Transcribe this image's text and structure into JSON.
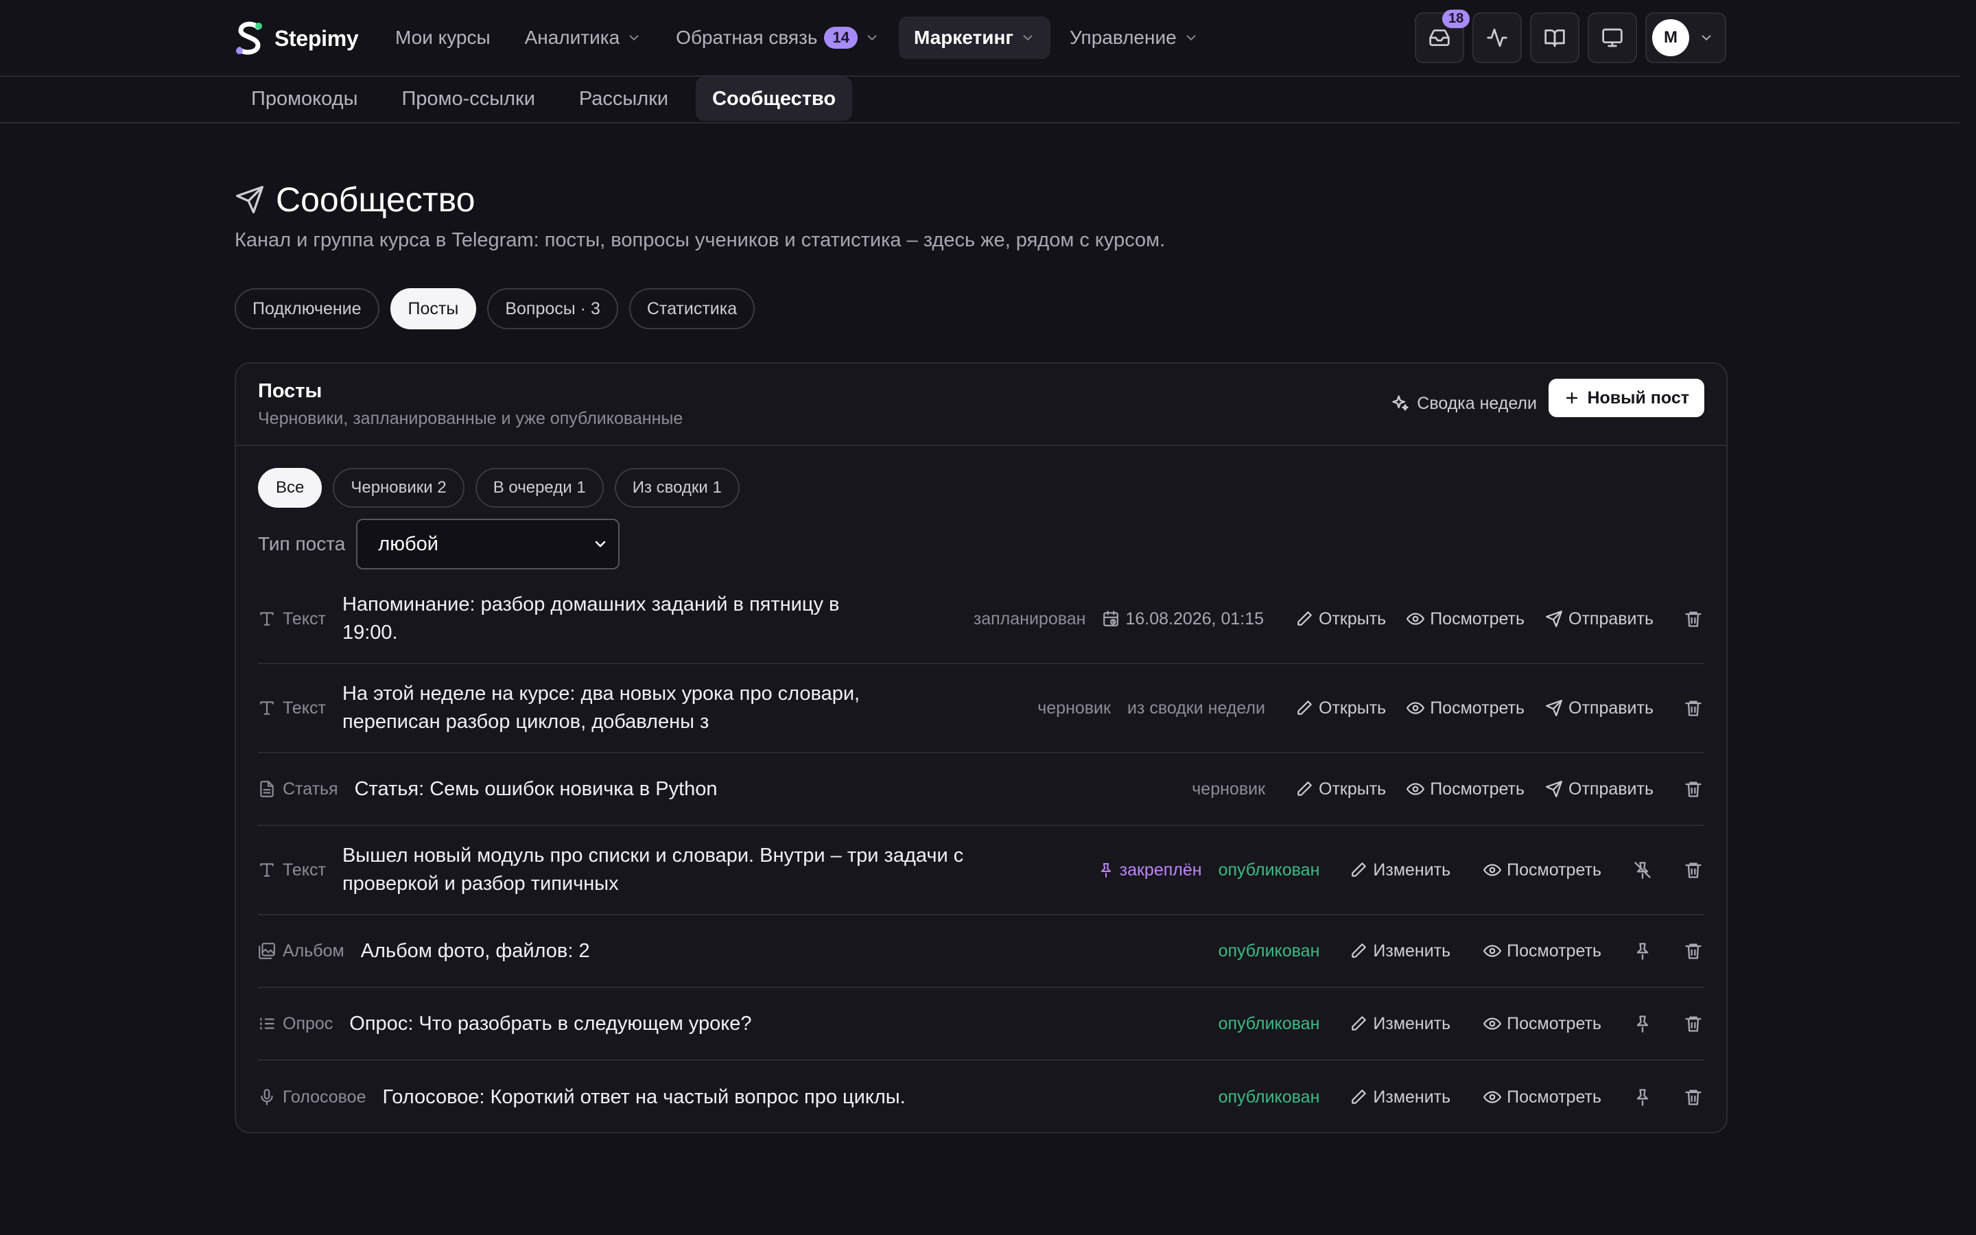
{
  "app": {
    "logo_text": "Stepimy"
  },
  "nav": {
    "items": [
      {
        "label": "Мои курсы"
      },
      {
        "label": "Аналитика"
      },
      {
        "label": "Обратная связь",
        "badge": "14"
      },
      {
        "label": "Маркетинг"
      },
      {
        "label": "Управление"
      }
    ]
  },
  "toolbar": {
    "inbox_badge": "18",
    "avatar_initial": "M"
  },
  "subnav": {
    "items": [
      {
        "label": "Промокоды"
      },
      {
        "label": "Промо-ссылки"
      },
      {
        "label": "Рассылки"
      },
      {
        "label": "Сообщество"
      }
    ]
  },
  "page": {
    "title": "Сообщество",
    "subtitle": "Канал и группа курса в Telegram: посты, вопросы учеников и статистика – здесь же, рядом с курсом.",
    "tabs": [
      {
        "label": "Подключение"
      },
      {
        "label": "Посты"
      },
      {
        "label": "Вопросы · 3"
      },
      {
        "label": "Статистика"
      }
    ]
  },
  "card": {
    "title": "Посты",
    "subtitle": "Черновики, запланированные и уже опубликованные",
    "digest_button": "Сводка недели",
    "new_button": "Новый пост",
    "filters": [
      {
        "label": "Все"
      },
      {
        "label": "Черновики 2"
      },
      {
        "label": "В очереди 1"
      },
      {
        "label": "Из сводки 1"
      }
    ],
    "type_filter_label": "Тип поста",
    "type_filter_value": "любой"
  },
  "posts": [
    {
      "type": "Текст",
      "title": "Напоминание: разбор домашних заданий в пятницу в 19:00.",
      "status": "запланирован",
      "date": "16.08.2026, 01:15",
      "actions": [
        "Открыть",
        "Посмотреть",
        "Отправить"
      ]
    },
    {
      "type": "Текст",
      "title": "На этой неделе на курсе: два новых урока про словари, переписан разбор циклов, добавлены з",
      "status": "черновик",
      "source": "из сводки недели",
      "actions": [
        "Открыть",
        "Посмотреть",
        "Отправить"
      ]
    },
    {
      "type": "Статья",
      "title": "Статья: Семь ошибок новичка в Python",
      "status": "черновик",
      "actions": [
        "Открыть",
        "Посмотреть",
        "Отправить"
      ]
    },
    {
      "type": "Текст",
      "title": "Вышел новый модуль про списки и словари. Внутри – три задачи с проверкой и разбор типичных",
      "pinned": "закреплён",
      "status": "опубликован",
      "actions": [
        "Изменить",
        "Посмотреть"
      ]
    },
    {
      "type": "Альбом",
      "title": "Альбом фото, файлов: 2",
      "status": "опубликован",
      "actions": [
        "Изменить",
        "Посмотреть"
      ]
    },
    {
      "type": "Опрос",
      "title": "Опрос: Что разобрать в следующем уроке?",
      "status": "опубликован",
      "actions": [
        "Изменить",
        "Посмотреть"
      ]
    },
    {
      "type": "Голосовое",
      "title": "Голосовое: Короткий ответ на частый вопрос про циклы.",
      "status": "опубликован",
      "actions": [
        "Изменить",
        "Посмотреть"
      ]
    }
  ],
  "colors": {
    "background": "#131218",
    "accent_badge": "#a78bfa",
    "published": "#3dbb84",
    "pinned": "#c084fc"
  }
}
